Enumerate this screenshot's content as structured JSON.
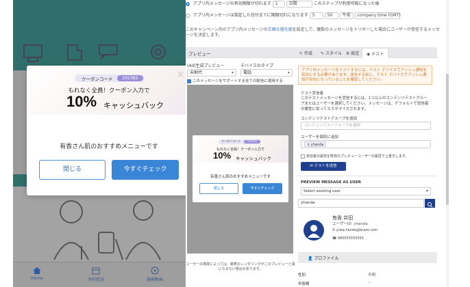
{
  "phone": {
    "modal": {
      "coupon_label": "クーポンコード",
      "coupon_code": "2023B2",
      "line1": "もれなく全員！クーポン入力で",
      "big": "10%",
      "big_suffix": "キャッシュバック",
      "body": "有香さん肌のおすすめメニューです",
      "close_button": "閉じる",
      "cta_button": "今すぐチェック",
      "close_glyph": "×"
    },
    "nav": [
      {
        "label": "Home",
        "icon": "home-icon"
      },
      {
        "label": "予約状況",
        "icon": "calendar-icon"
      },
      {
        "label": "施術動画",
        "icon": "play-icon"
      }
    ]
  },
  "panel": {
    "radio1": {
      "label": "アプリ内メッセージの有効期限が切れます",
      "value": "1",
      "unit": "日間",
      "suffix": "このステップが利用可能になった後"
    },
    "radio2": {
      "label": "アプリ内メッセージは指定した日付までに期限切れになります",
      "hour": "5",
      "minute": "50",
      "ampm": "午前",
      "tz": "company time (GMT)"
    },
    "description_pre": "このキャンペーン内のアプリ内メッセージの",
    "description_link": "正確な優先度",
    "description_post": "を設定して、複数のメッセージをトリガーした場合にユーザーが受信するメッセージを決定します。",
    "preview_title": "プレビュー",
    "tabs": [
      "作成",
      "スタイル",
      "設定",
      "テスト"
    ],
    "preview": {
      "label_left": "(Ad)生成プレビュー",
      "label_right": "デバイスのタイプ",
      "select_left": "未割代",
      "select_right": "電話",
      "checkbox": "このメッセージをサポートする全ての配信に適用する",
      "footer": "ユーザーの環境によっては、実際のレンダリングがこのプレビューと異になるない場合があります。"
    },
    "test": {
      "warning": "アプリ内メッセージをテストするには、テスト デバイスでプッシュ通知を有効にする必要があります。送信する前に、テスト デバイスでプッシュ通知が有効になっていることを確認してください。",
      "recipients_label": "テスト受信者",
      "recipients_text": "このテストメッセージを受信するには、1つ以上のコンテンツテストグループまたはユーザーを選択してください。メッセージは、デフォルトで受信者の属性に従ってカスタマイズされます。",
      "groups_label": "コンテンツテストグループを追加",
      "groups_placeholder": "コンテンツテストグループを選択",
      "users_label": "ユーザーを個別に追加",
      "user_chip": "× yhanda",
      "override_check": "受信者の属性を既存のプレビューユーザーの属性で上書きします。",
      "send_button": "テストを送信",
      "preview_as_title": "PREVIEW MESSAGE AS USER",
      "existing_user": "Select existing user",
      "search_value": "yhanda"
    },
    "user": {
      "name": "有香 井田",
      "id": "ユーザーID: yhanda",
      "email": "yuka.handa@braze.com",
      "phone": "080555555555"
    },
    "profile": {
      "title": "プロファイル",
      "rows": [
        {
          "k": "性別",
          "v": "不明"
        },
        {
          "k": "年齢層",
          "v": "--"
        }
      ]
    }
  }
}
